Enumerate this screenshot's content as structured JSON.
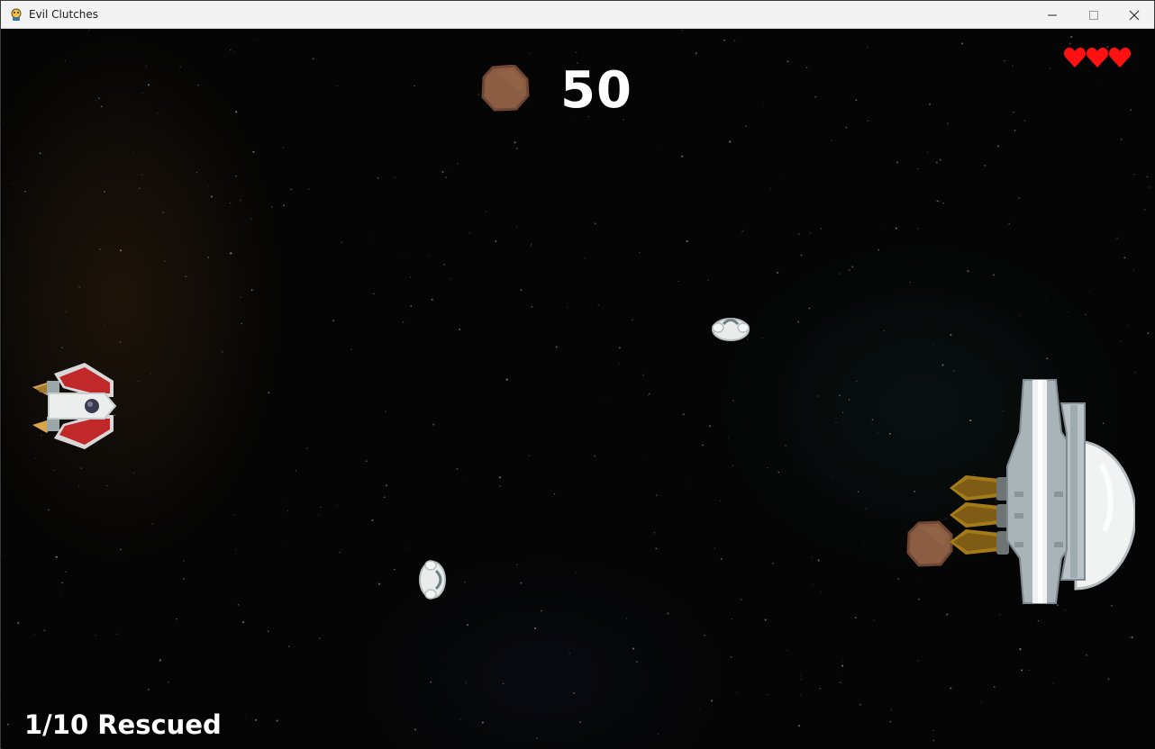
{
  "window": {
    "title": "Evil Clutches",
    "icon": "pygame-snake-icon",
    "controls": [
      "minimize-icon",
      "maximize-icon",
      "close-icon"
    ]
  },
  "hud": {
    "score": "50",
    "rescued_text": "1/10 Rescued",
    "lives": 3,
    "heart_color": "#ff1111"
  },
  "sprites": {
    "player": "red-white-fighter-ship",
    "boss": "grey-dome-mothership",
    "asteroids": 2,
    "astronauts": 2
  },
  "colors": {
    "background": "#050505",
    "asteroid": "#8b5e43",
    "text": "#ffffff"
  }
}
